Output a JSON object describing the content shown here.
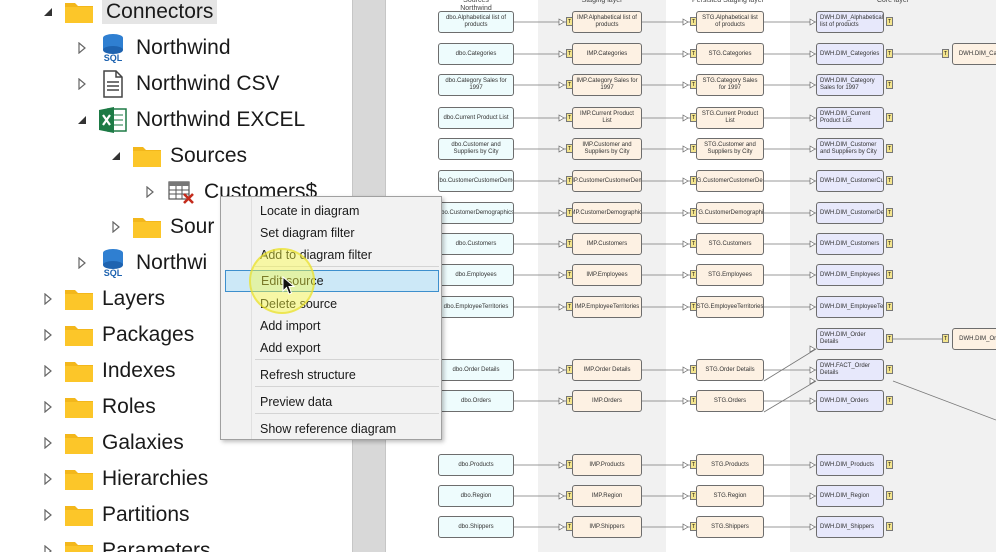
{
  "tree": {
    "items": [
      {
        "label": "Connectors",
        "icon": "folder-icon",
        "level": 0,
        "expanded": true
      },
      {
        "label": "Northwind",
        "icon": "sql-database-icon",
        "level": 1,
        "expanded": false
      },
      {
        "label": "Northwind CSV",
        "icon": "csv-file-icon",
        "level": 1,
        "expanded": false
      },
      {
        "label": "Northwind EXCEL",
        "icon": "excel-icon",
        "level": 1,
        "expanded": true
      },
      {
        "label": "Sources",
        "icon": "folder-icon",
        "level": 2,
        "expanded": true
      },
      {
        "label": "Customers$",
        "icon": "table-error-icon",
        "level": 3,
        "expanded": false
      },
      {
        "label": "Sour",
        "icon": "folder-icon",
        "level": 2,
        "expanded": false
      },
      {
        "label": "Northwi",
        "icon": "sql-database-icon",
        "level": 1,
        "expanded": false
      },
      {
        "label": "Layers",
        "icon": "folder-icon",
        "level": 0,
        "expanded": false
      },
      {
        "label": "Packages",
        "icon": "folder-icon",
        "level": 0,
        "expanded": false
      },
      {
        "label": "Indexes",
        "icon": "folder-icon",
        "level": 0,
        "expanded": false
      },
      {
        "label": "Roles",
        "icon": "folder-icon",
        "level": 0,
        "expanded": false
      },
      {
        "label": "Galaxies",
        "icon": "folder-icon",
        "level": 0,
        "expanded": false
      },
      {
        "label": "Hierarchies",
        "icon": "folder-icon",
        "level": 0,
        "expanded": false
      },
      {
        "label": "Partitions",
        "icon": "folder-icon",
        "level": 0,
        "expanded": false
      },
      {
        "label": "Parameters",
        "icon": "folder-icon",
        "level": 0,
        "expanded": false
      }
    ],
    "sql_badge": "SQL"
  },
  "context_menu": {
    "items": [
      {
        "label": "Locate in diagram",
        "highlighted": false
      },
      {
        "label": "Set diagram filter",
        "highlighted": false
      },
      {
        "label": "Add to diagram filter",
        "highlighted": false
      },
      {
        "label": "Edit source",
        "highlighted": true
      },
      {
        "label": "Delete source",
        "highlighted": false
      },
      {
        "label": "Add import",
        "highlighted": false
      },
      {
        "label": "Add export",
        "highlighted": false
      },
      {
        "label": "Refresh structure",
        "highlighted": false
      },
      {
        "label": "Preview data",
        "highlighted": false
      },
      {
        "label": "Show reference diagram",
        "highlighted": false
      }
    ]
  },
  "diagram": {
    "lanes": [
      {
        "title": "Sources",
        "subtitle": "Northwind"
      },
      {
        "title": "Staging layer",
        "subtitle": ""
      },
      {
        "title": "Persisted Staging layer",
        "subtitle": ""
      },
      {
        "title": "Core layer",
        "subtitle": ""
      }
    ],
    "rows": [
      {
        "src": "dbo.Alphabetical list of products",
        "imp": "IMP.Alphabetical list of products",
        "stg": "STG.Alphabetical list of products",
        "dwh": "DWH.DIM_Alphabetical list of products"
      },
      {
        "src": "dbo.Categories",
        "imp": "IMP.Categories",
        "stg": "STG.Categories",
        "dwh": "DWH.DIM_Categories"
      },
      {
        "src": "dbo.Category Sales for 1997",
        "imp": "IMP.Category Sales for 1997",
        "stg": "STG.Category Sales for 1997",
        "dwh": "DWH.DIM_Category Sales for 1997"
      },
      {
        "src": "dbo.Current Product List",
        "imp": "IMP.Current Product List",
        "stg": "STG.Current Product List",
        "dwh": "DWH.DIM_Current Product List"
      },
      {
        "src": "dbo.Customer and Suppliers by City",
        "imp": "IMP.Customer and Suppliers by City",
        "stg": "STG.Customer and Suppliers by City",
        "dwh": "DWH.DIM_Customer and Suppliers by City"
      },
      {
        "src": "dbo.CustomerCustomerDemo",
        "imp": "IMP.CustomerCustomerDemo",
        "stg": "STG.CustomerCustomerDemo",
        "dwh": "DWH.DIM_CustomerCustomerDemo"
      },
      {
        "src": "dbo.CustomerDemographics",
        "imp": "IMP.CustomerDemographics",
        "stg": "STG.CustomerDemographics",
        "dwh": "DWH.DIM_CustomerDemographics"
      },
      {
        "src": "dbo.Customers",
        "imp": "IMP.Customers",
        "stg": "STG.Customers",
        "dwh": "DWH.DIM_Customers"
      },
      {
        "src": "dbo.Employees",
        "imp": "IMP.Employees",
        "stg": "STG.Employees",
        "dwh": "DWH.DIM_Employees"
      },
      {
        "src": "dbo.EmployeeTerritories",
        "imp": "IMP.EmployeeTerritories",
        "stg": "STG.EmployeeTerritories",
        "dwh": "DWH.DIM_EmployeeTerritories"
      },
      {
        "src": "",
        "imp": "",
        "stg": "",
        "dwh": "DWH.DIM_Order Details"
      },
      {
        "src": "dbo.Order Details",
        "imp": "IMP.Order Details",
        "stg": "STG.Order Details",
        "dwh": "DWH.FACT_Order Details"
      },
      {
        "src": "dbo.Orders",
        "imp": "IMP.Orders",
        "stg": "STG.Orders",
        "dwh": "DWH.DIM_Orders"
      },
      {
        "src": "",
        "imp": "",
        "stg": "",
        "dwh": ""
      },
      {
        "src": "dbo.Products",
        "imp": "IMP.Products",
        "stg": "STG.Products",
        "dwh": "DWH.DIM_Products"
      },
      {
        "src": "dbo.Region",
        "imp": "IMP.Region",
        "stg": "STG.Region",
        "dwh": "DWH.DIM_Region"
      },
      {
        "src": "dbo.Shippers",
        "imp": "IMP.Shippers",
        "stg": "STG.Shippers",
        "dwh": "DWH.DIM_Shippers"
      }
    ],
    "extra_nodes": [
      {
        "label": "DWH.DIM_Categ",
        "row": 1
      },
      {
        "label": "DWH.DIM_Order",
        "row": 10
      }
    ],
    "tag_label": "T"
  },
  "colors": {
    "src_fill": "#eefcfd",
    "stage_fill": "#fdf1e3",
    "core_fill": "#e7e8fb",
    "menu_highlight": "#cce8f7",
    "cursor_highlight": "#ffff3c"
  }
}
